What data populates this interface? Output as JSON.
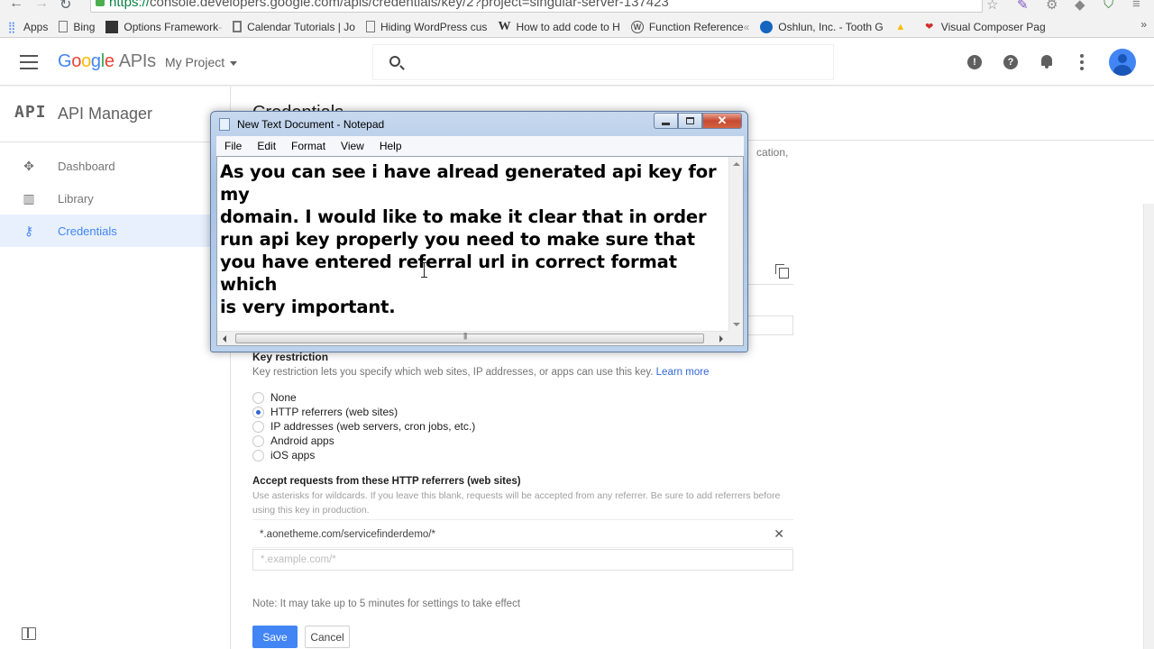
{
  "browser": {
    "url": "https://console.developers.google.com/apis/credentials/key/2?project=singular-server-137423",
    "url_secure_part": "https://",
    "url_rest": "console.developers.google.com/apis/credentials/key/2?project=singular-server-137423",
    "bookmarks": [
      {
        "label": "Apps",
        "icon": "apps-grid-icon"
      },
      {
        "label": "Bing",
        "icon": "page-icon"
      },
      {
        "label": "Options Framework",
        "suffix": " -",
        "icon": "options-framework-icon"
      },
      {
        "label": "Calendar Tutorials | Jo",
        "icon": "calendar-tutorials-icon"
      },
      {
        "label": "Hiding WordPress cus",
        "icon": "page-icon"
      },
      {
        "label": "How to add code to H",
        "icon": "wikipedia-icon"
      },
      {
        "label": "Function Reference",
        "suffix": " «",
        "icon": "wordpress-icon"
      },
      {
        "label": "Oshlun, Inc. - Tooth G",
        "icon": "oshlun-icon"
      },
      {
        "label": "",
        "icon": "drive-icon"
      },
      {
        "label": "Visual Composer Pag",
        "icon": "visual-composer-icon"
      }
    ]
  },
  "header": {
    "logo": {
      "g": "G",
      "o1": "o",
      "o2": "o",
      "g2": "g",
      "l": "l",
      "e": "e",
      "apis": "APIs"
    },
    "project": "My Project"
  },
  "sidebar": {
    "section_mark": "API",
    "section_name": "API Manager",
    "items": [
      {
        "label": "Dashboard",
        "icon": "dashboard-icon",
        "active": false
      },
      {
        "label": "Library",
        "icon": "library-icon",
        "active": false
      },
      {
        "label": "Credentials",
        "icon": "key-icon",
        "active": true
      }
    ]
  },
  "main": {
    "page_title": "Credentials",
    "bg_snippet": "cation,",
    "key_restriction": {
      "title": "Key restriction",
      "description": "Key restriction lets you specify which web sites, IP addresses, or apps can use this key.",
      "learn_more": "Learn more",
      "options": [
        {
          "label": "None",
          "selected": false
        },
        {
          "label": "HTTP referrers (web sites)",
          "selected": true
        },
        {
          "label": "IP addresses (web servers, cron jobs, etc.)",
          "selected": false
        },
        {
          "label": "Android apps",
          "selected": false
        },
        {
          "label": "iOS apps",
          "selected": false
        }
      ]
    },
    "accept": {
      "title": "Accept requests from these HTTP referrers (web sites)",
      "description": "Use asterisks for wildcards. If you leave this blank, requests will be accepted from any referrer. Be sure to add referrers before using this key in production.",
      "referrers": [
        "*.aonetheme.com/servicefinderdemo/*"
      ],
      "input_placeholder": "*.example.com/*"
    },
    "note": "Note: It may take up to 5 minutes for settings to take effect",
    "save_label": "Save",
    "cancel_label": "Cancel"
  },
  "notepad": {
    "title": "New Text Document - Notepad",
    "menus": [
      "File",
      "Edit",
      "Format",
      "View",
      "Help"
    ],
    "content": "As you can see i have alread generated api key for my\ndomain. I would like to make it clear that in order\nrun api key properly you need to make sure that\nyou have entered referral url in correct format which\nis very important.",
    "close_glyph": "✕"
  }
}
